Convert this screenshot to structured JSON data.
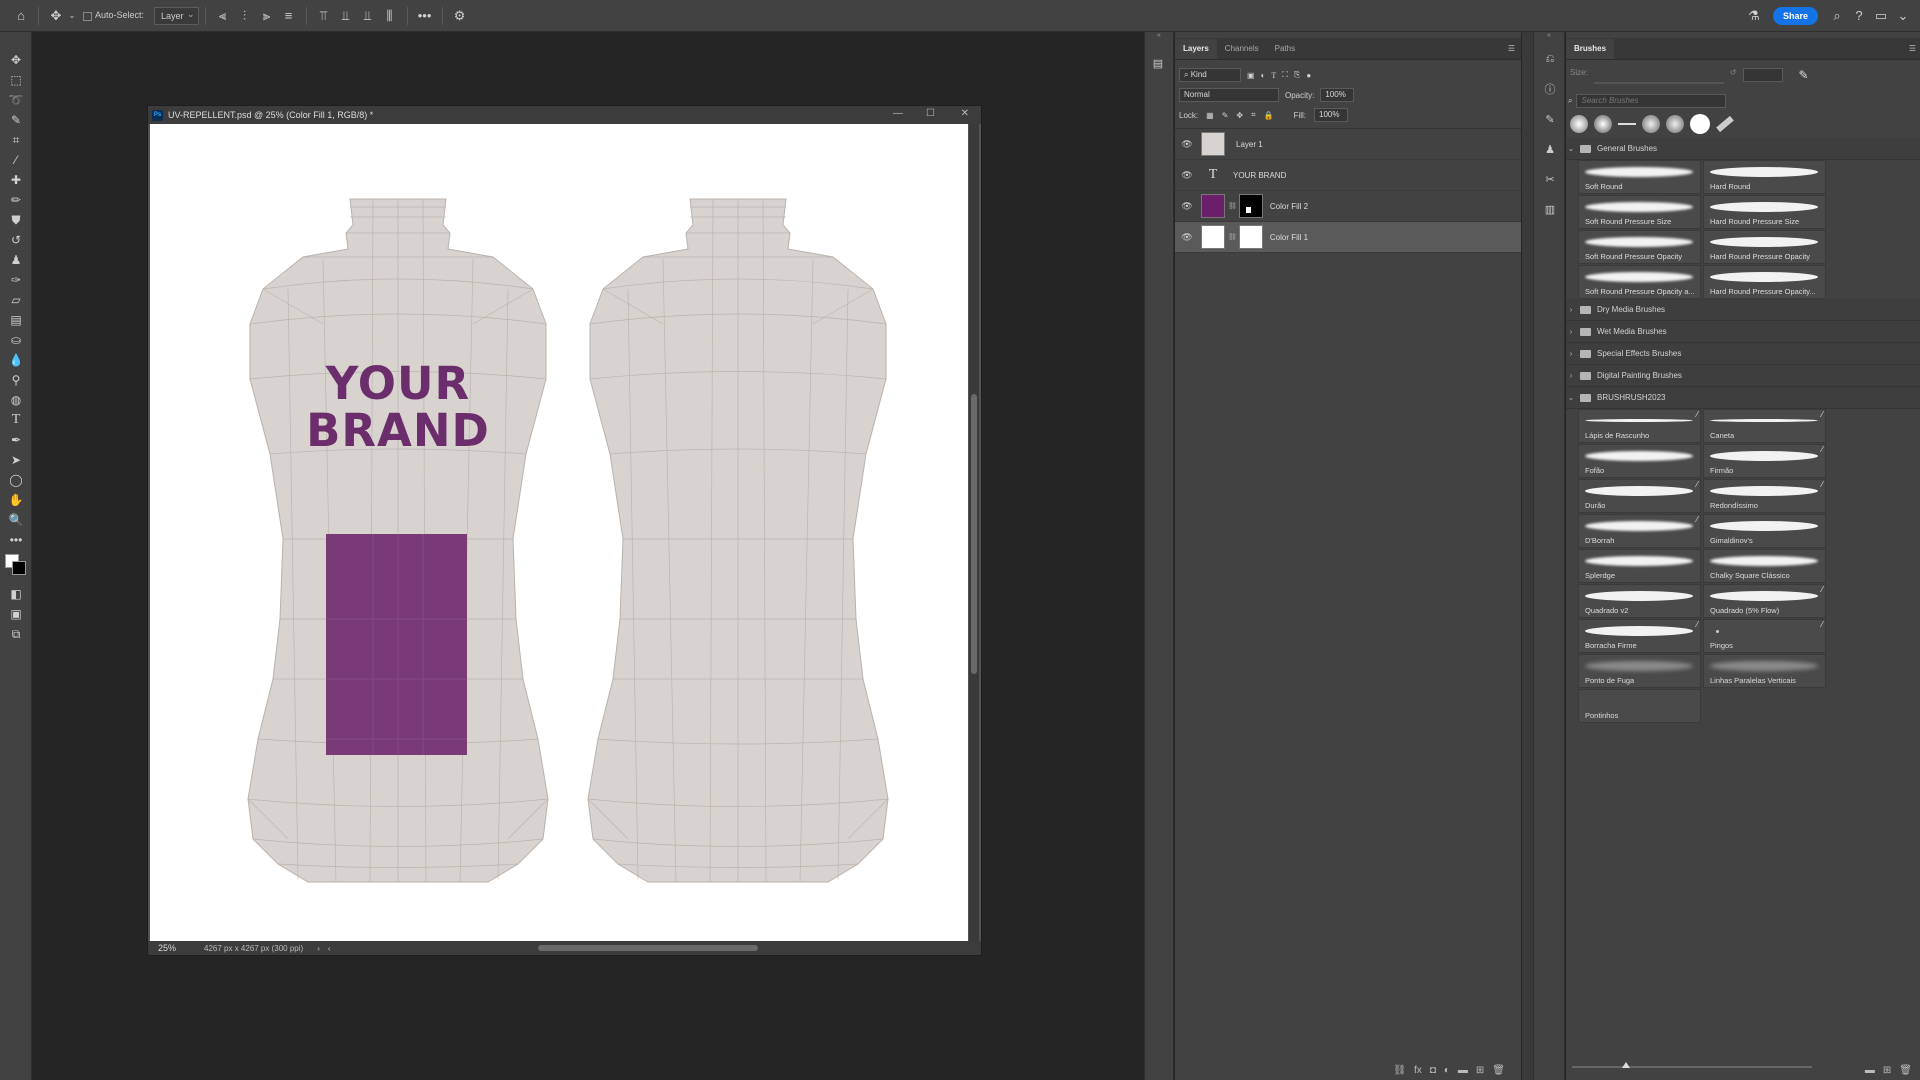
{
  "options_bar": {
    "auto_select_label": "Auto-Select:",
    "auto_select_target": "Layer",
    "share_label": "Share"
  },
  "document": {
    "title": "UV-REPELLENT.psd @ 25% (Color Fill 1, RGB/8) *",
    "zoom": "25%",
    "dimensions": "4267 px x 4267 px (300 ppi)",
    "brand_text_line1": "YOUR",
    "brand_text_line2": "BRAND",
    "brand_color": "#6b2d6b",
    "label_color": "#7a3a78",
    "bottle_color": "#d8d3cf"
  },
  "layers_panel": {
    "tabs": [
      "Layers",
      "Channels",
      "Paths"
    ],
    "filter_kind": "Kind",
    "blend_mode": "Normal",
    "opacity_label": "Opacity:",
    "opacity_value": "100%",
    "lock_label": "Lock:",
    "fill_label": "Fill:",
    "fill_value": "100%",
    "layers": [
      {
        "name": "Layer 1",
        "type": "pixel",
        "selected": false
      },
      {
        "name": "YOUR BRAND",
        "type": "text",
        "selected": false
      },
      {
        "name": "Color Fill 2",
        "type": "fill",
        "color": "#6b1f6b",
        "selected": false
      },
      {
        "name": "Color Fill 1",
        "type": "fill",
        "color": "#ffffff",
        "selected": true
      }
    ]
  },
  "brushes_panel": {
    "tab": "Brushes",
    "size_label": "Size:",
    "search_placeholder": "Search Brushes",
    "general_group": "General Brushes",
    "general_brushes": [
      "Soft Round",
      "Hard Round",
      "Soft Round Pressure Size",
      "Hard Round Pressure Size",
      "Soft Round Pressure Opacity",
      "Hard Round Pressure Opacity",
      "Soft Round Pressure Opacity a...",
      "Hard Round Pressure Opacity..."
    ],
    "collapsed_groups": [
      "Dry Media Brushes",
      "Wet Media Brushes",
      "Special Effects Brushes",
      "Digital Painting Brushes"
    ],
    "custom_group": "BRUSHRUSH2023",
    "custom_brushes": [
      "Lápis de Rascunho",
      "Caneta",
      "Fofão",
      "Firmão",
      "Durão",
      "Redondíssimo",
      "D'Borrah",
      "Gimaldinov's",
      "Splerdge",
      "Chalky Square Clássico",
      "Quadrado v2",
      "Quadrado (5% Flow)",
      "Borracha Firme",
      "Pingos",
      "Ponto de Fuga",
      "Linhas Paralelas Verticais",
      "Pontinhos"
    ]
  }
}
